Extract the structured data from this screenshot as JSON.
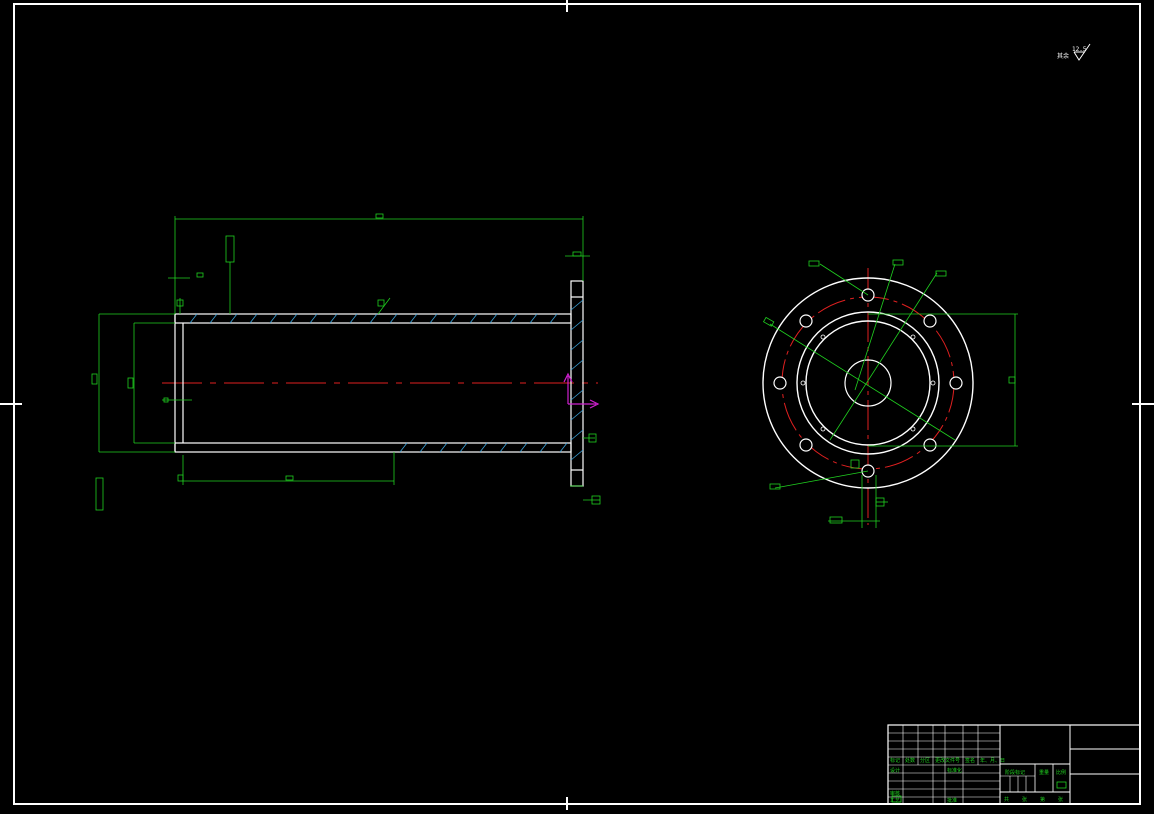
{
  "drawing": {
    "roughness_symbol": {
      "prefix": "其余",
      "value": "12.5"
    },
    "title_block": {
      "grid_labels": [
        "标记",
        "处数",
        "分区",
        "更改文件号",
        "签名",
        "年、月、日"
      ],
      "row2_labels": [
        "设计",
        "",
        "标准化"
      ],
      "stage_labels": [
        "阶段标记",
        "重量",
        "比例"
      ],
      "bottom_labels": [
        "共",
        "张",
        "第",
        "张"
      ],
      "approve_labels": [
        "审核",
        "工艺",
        "批准"
      ]
    }
  }
}
